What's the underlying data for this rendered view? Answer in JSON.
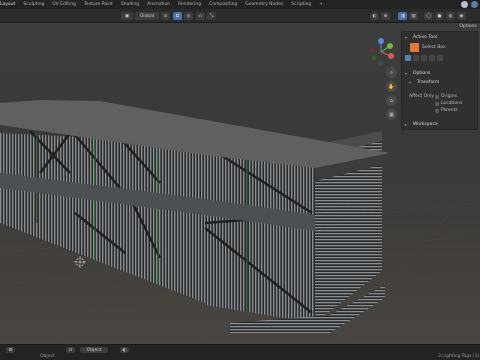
{
  "workspace_tabs": [
    "Layout",
    "Sculpting",
    "UV Editing",
    "Texture Paint",
    "Shading",
    "Animation",
    "Rendering",
    "Compositing",
    "Geometry Nodes",
    "Scripting"
  ],
  "add_tab": "+",
  "header": {
    "orientation": "Global",
    "options_label": "Options"
  },
  "npanel": {
    "active_tool_title": "Active Tool",
    "select_box_label": "Select Box",
    "options_title": "Options",
    "transform_label": "Transform",
    "affect_only_label": "Affect Only",
    "origins_label": "Origins",
    "locations_label": "Locations",
    "parents_label": "Parents",
    "workspace_label": "Workspace"
  },
  "gizmo": {
    "x_axis": "X",
    "y_axis": "Y",
    "z_axis": "Z"
  },
  "status": {
    "mode": "Object",
    "left_text": "Object",
    "right_text": "3.Lighting Rigs (1)"
  }
}
